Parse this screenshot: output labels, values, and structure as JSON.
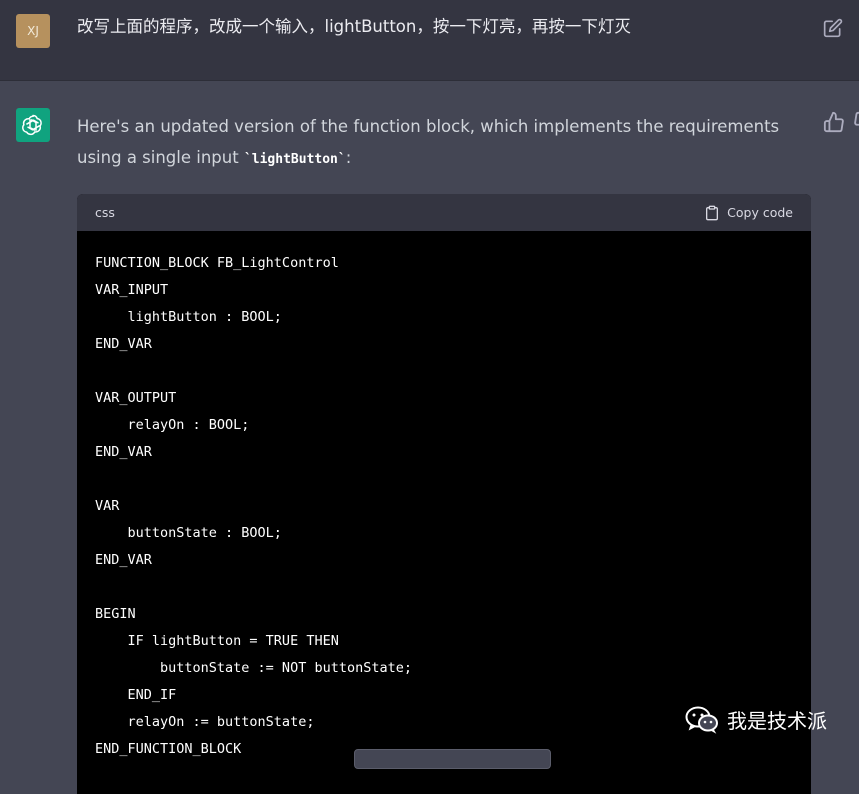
{
  "user_message": {
    "avatar_initials": "XJ",
    "text": "改写上面的程序，改成一个输入，lightButton，按一下灯亮，再按一下灯灭",
    "edit_icon": "edit-icon"
  },
  "assistant_message": {
    "intro_before": "Here's an updated version of the function block, which implements the requirements using a single input ",
    "intro_code": "`lightButton`",
    "intro_after": ":",
    "code_block": {
      "language": "css",
      "copy_label": "Copy code",
      "lines": [
        "FUNCTION_BLOCK FB_LightControl",
        "VAR_INPUT",
        "    lightButton : BOOL;",
        "END_VAR",
        "",
        "VAR_OUTPUT",
        "    relayOn : BOOL;",
        "END_VAR",
        "",
        "VAR",
        "    buttonState : BOOL;",
        "END_VAR",
        "",
        "BEGIN",
        "    IF lightButton = TRUE THEN",
        "        buttonState := NOT buttonState;",
        "    END_IF",
        "    relayOn := buttonState;",
        "END_FUNCTION_BLOCK"
      ]
    }
  },
  "watermark": {
    "text": "我是技术派",
    "icon": "wechat-icon"
  },
  "colors": {
    "user_bg": "#343541",
    "assistant_bg": "#444654",
    "gpt_avatar": "#10a37f",
    "user_avatar": "#b6915e",
    "code_bg": "#000000"
  }
}
